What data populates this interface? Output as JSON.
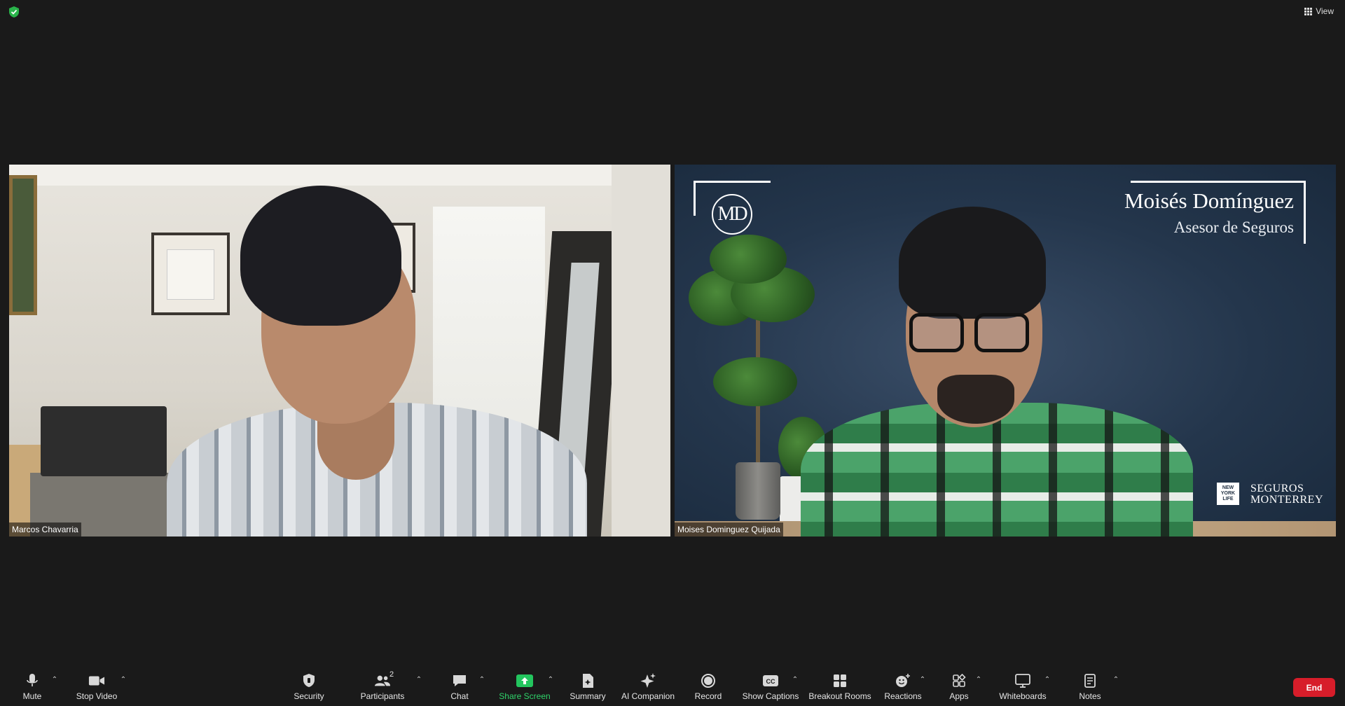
{
  "top_bar": {
    "security_shield_color": "#29b34a",
    "view_label": "View"
  },
  "participants": [
    {
      "name": "Marcos Chavarria"
    },
    {
      "name": "Moises Dominguez Quijada"
    }
  ],
  "virtual_background": {
    "logo_initials": "MD",
    "brand_name": "Moisés Domínguez",
    "brand_title": "Asesor de Seguros",
    "nyl_text": "NEW YORK LIFE",
    "company_line1": "SEGUROS",
    "company_line2": "MONTERREY"
  },
  "toolbar": {
    "mute": "Mute",
    "stop_video": "Stop Video",
    "security": "Security",
    "participants": "Participants",
    "participants_count": "2",
    "chat": "Chat",
    "share_screen": "Share Screen",
    "summary": "Summary",
    "ai_companion": "AI Companion",
    "record": "Record",
    "show_captions": "Show Captions",
    "breakout_rooms": "Breakout Rooms",
    "reactions": "Reactions",
    "apps": "Apps",
    "whiteboards": "Whiteboards",
    "notes": "Notes",
    "end": "End",
    "accent_share": "#23c55e",
    "accent_end": "#d71d2a"
  }
}
